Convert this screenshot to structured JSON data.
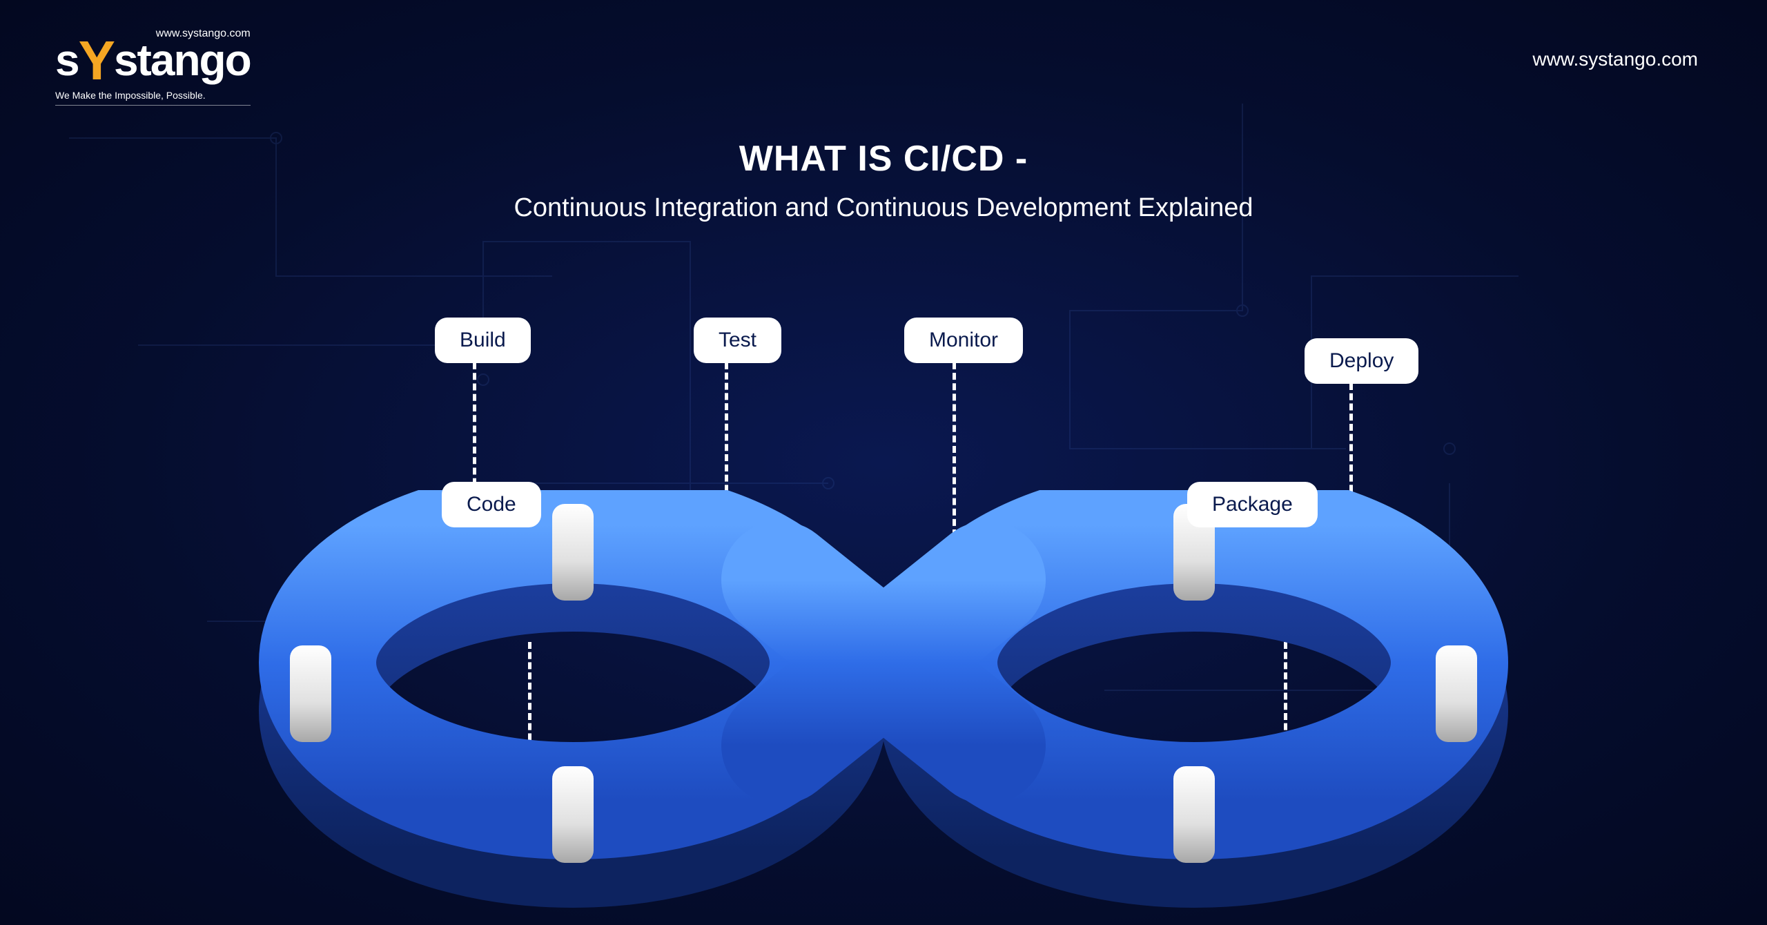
{
  "logo": {
    "url_small": "www.systango.com",
    "name_s": "s",
    "name_y": "Y",
    "name_rest": "stango",
    "tagline": "We Make the Impossible, Possible."
  },
  "top_right_url": "www.systango.com",
  "title": "WHAT IS CI/CD -",
  "subtitle": "Continuous Integration and Continuous Development Explained",
  "stages": {
    "build": "Build",
    "code": "Code",
    "test": "Test",
    "monitor": "Monitor",
    "package": "Package",
    "deploy": "Deploy"
  },
  "colors": {
    "loop_top": "#3b82f6",
    "loop_mid": "#2563eb",
    "loop_dark": "#1e3a8a",
    "accent": "#f5a623"
  }
}
